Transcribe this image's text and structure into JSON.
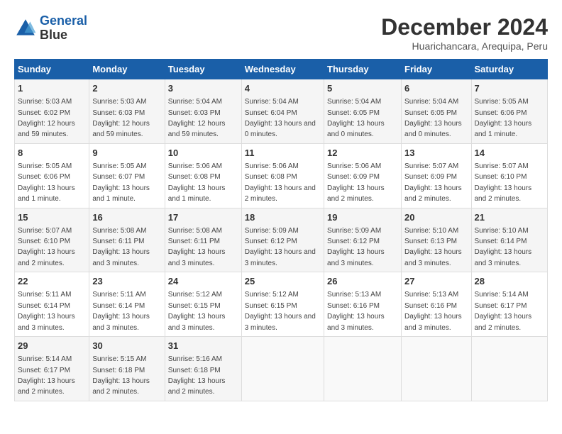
{
  "logo": {
    "line1": "General",
    "line2": "Blue"
  },
  "title": "December 2024",
  "subtitle": "Huarichancara, Arequipa, Peru",
  "days_of_week": [
    "Sunday",
    "Monday",
    "Tuesday",
    "Wednesday",
    "Thursday",
    "Friday",
    "Saturday"
  ],
  "weeks": [
    [
      {
        "day": "1",
        "sunrise": "5:03 AM",
        "sunset": "6:02 PM",
        "daylight": "12 hours and 59 minutes."
      },
      {
        "day": "2",
        "sunrise": "5:03 AM",
        "sunset": "6:03 PM",
        "daylight": "12 hours and 59 minutes."
      },
      {
        "day": "3",
        "sunrise": "5:04 AM",
        "sunset": "6:03 PM",
        "daylight": "12 hours and 59 minutes."
      },
      {
        "day": "4",
        "sunrise": "5:04 AM",
        "sunset": "6:04 PM",
        "daylight": "13 hours and 0 minutes."
      },
      {
        "day": "5",
        "sunrise": "5:04 AM",
        "sunset": "6:05 PM",
        "daylight": "13 hours and 0 minutes."
      },
      {
        "day": "6",
        "sunrise": "5:04 AM",
        "sunset": "6:05 PM",
        "daylight": "13 hours and 0 minutes."
      },
      {
        "day": "7",
        "sunrise": "5:05 AM",
        "sunset": "6:06 PM",
        "daylight": "13 hours and 1 minute."
      }
    ],
    [
      {
        "day": "8",
        "sunrise": "5:05 AM",
        "sunset": "6:06 PM",
        "daylight": "13 hours and 1 minute."
      },
      {
        "day": "9",
        "sunrise": "5:05 AM",
        "sunset": "6:07 PM",
        "daylight": "13 hours and 1 minute."
      },
      {
        "day": "10",
        "sunrise": "5:06 AM",
        "sunset": "6:08 PM",
        "daylight": "13 hours and 1 minute."
      },
      {
        "day": "11",
        "sunrise": "5:06 AM",
        "sunset": "6:08 PM",
        "daylight": "13 hours and 2 minutes."
      },
      {
        "day": "12",
        "sunrise": "5:06 AM",
        "sunset": "6:09 PM",
        "daylight": "13 hours and 2 minutes."
      },
      {
        "day": "13",
        "sunrise": "5:07 AM",
        "sunset": "6:09 PM",
        "daylight": "13 hours and 2 minutes."
      },
      {
        "day": "14",
        "sunrise": "5:07 AM",
        "sunset": "6:10 PM",
        "daylight": "13 hours and 2 minutes."
      }
    ],
    [
      {
        "day": "15",
        "sunrise": "5:07 AM",
        "sunset": "6:10 PM",
        "daylight": "13 hours and 2 minutes."
      },
      {
        "day": "16",
        "sunrise": "5:08 AM",
        "sunset": "6:11 PM",
        "daylight": "13 hours and 3 minutes."
      },
      {
        "day": "17",
        "sunrise": "5:08 AM",
        "sunset": "6:11 PM",
        "daylight": "13 hours and 3 minutes."
      },
      {
        "day": "18",
        "sunrise": "5:09 AM",
        "sunset": "6:12 PM",
        "daylight": "13 hours and 3 minutes."
      },
      {
        "day": "19",
        "sunrise": "5:09 AM",
        "sunset": "6:12 PM",
        "daylight": "13 hours and 3 minutes."
      },
      {
        "day": "20",
        "sunrise": "5:10 AM",
        "sunset": "6:13 PM",
        "daylight": "13 hours and 3 minutes."
      },
      {
        "day": "21",
        "sunrise": "5:10 AM",
        "sunset": "6:14 PM",
        "daylight": "13 hours and 3 minutes."
      }
    ],
    [
      {
        "day": "22",
        "sunrise": "5:11 AM",
        "sunset": "6:14 PM",
        "daylight": "13 hours and 3 minutes."
      },
      {
        "day": "23",
        "sunrise": "5:11 AM",
        "sunset": "6:14 PM",
        "daylight": "13 hours and 3 minutes."
      },
      {
        "day": "24",
        "sunrise": "5:12 AM",
        "sunset": "6:15 PM",
        "daylight": "13 hours and 3 minutes."
      },
      {
        "day": "25",
        "sunrise": "5:12 AM",
        "sunset": "6:15 PM",
        "daylight": "13 hours and 3 minutes."
      },
      {
        "day": "26",
        "sunrise": "5:13 AM",
        "sunset": "6:16 PM",
        "daylight": "13 hours and 3 minutes."
      },
      {
        "day": "27",
        "sunrise": "5:13 AM",
        "sunset": "6:16 PM",
        "daylight": "13 hours and 3 minutes."
      },
      {
        "day": "28",
        "sunrise": "5:14 AM",
        "sunset": "6:17 PM",
        "daylight": "13 hours and 2 minutes."
      }
    ],
    [
      {
        "day": "29",
        "sunrise": "5:14 AM",
        "sunset": "6:17 PM",
        "daylight": "13 hours and 2 minutes."
      },
      {
        "day": "30",
        "sunrise": "5:15 AM",
        "sunset": "6:18 PM",
        "daylight": "13 hours and 2 minutes."
      },
      {
        "day": "31",
        "sunrise": "5:16 AM",
        "sunset": "6:18 PM",
        "daylight": "13 hours and 2 minutes."
      },
      null,
      null,
      null,
      null
    ]
  ]
}
